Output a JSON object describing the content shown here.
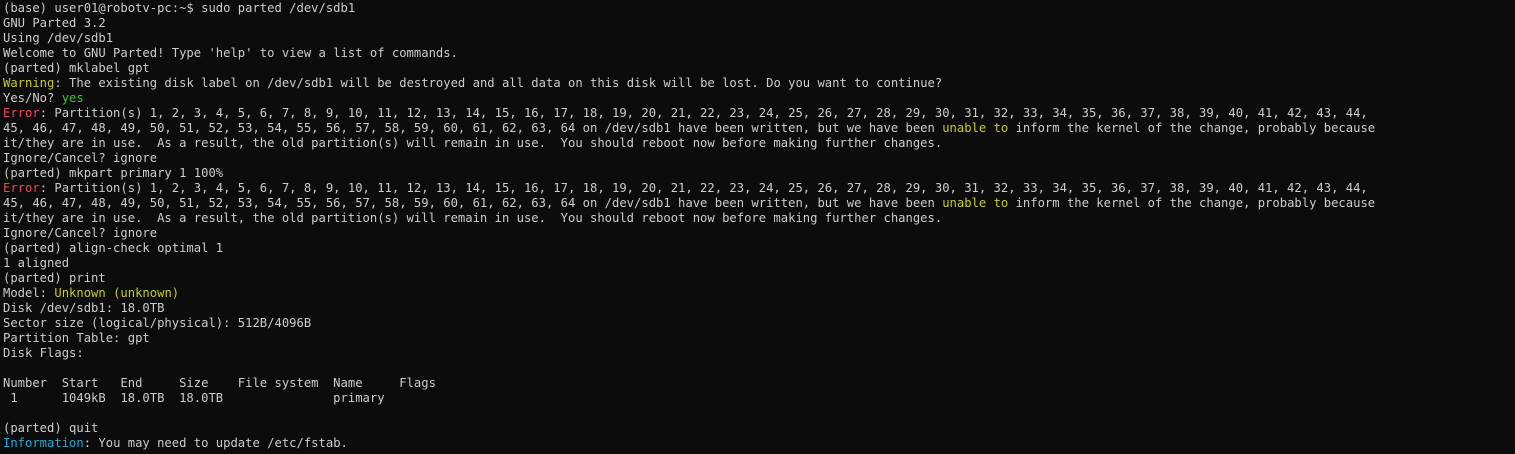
{
  "terminal": {
    "colors": {
      "background": "#0c0c0c",
      "foreground": "#cccccc",
      "warning": "#c8c832",
      "error": "#e74856",
      "highlight": "#c8c832",
      "answer": "#3ec23e",
      "information": "#2aa8d8"
    },
    "lines": [
      [
        {
          "t": "(base) user01@robotv-pc:~$ sudo parted /dev/sdb1",
          "c": "default"
        }
      ],
      [
        {
          "t": "GNU Parted 3.2",
          "c": "default"
        }
      ],
      [
        {
          "t": "Using /dev/sdb1",
          "c": "default"
        }
      ],
      [
        {
          "t": "Welcome to GNU Parted! Type 'help' to view a list of commands.",
          "c": "default"
        }
      ],
      [
        {
          "t": "(parted) mklabel gpt",
          "c": "default"
        }
      ],
      [
        {
          "t": "Warning",
          "c": "warning"
        },
        {
          "t": ": The existing disk label on /dev/sdb1 will be destroyed and all data on this disk will be lost. Do you want to continue?",
          "c": "default"
        }
      ],
      [
        {
          "t": "Yes/No? ",
          "c": "default"
        },
        {
          "t": "yes",
          "c": "green"
        }
      ],
      [
        {
          "t": "Error",
          "c": "error"
        },
        {
          "t": ": Partition(s) 1, 2, 3, 4, 5, 6, 7, 8, 9, 10, 11, 12, 13, 14, 15, 16, 17, 18, 19, 20, 21, 22, 23, 24, 25, 26, 27, 28, 29, 30, 31, 32, 33, 34, 35, 36, 37, 38, 39, 40, 41, 42, 43, 44,",
          "c": "default"
        }
      ],
      [
        {
          "t": "45, 46, 47, 48, 49, 50, 51, 52, 53, 54, 55, 56, 57, 58, 59, 60, 61, 62, 63, 64 on /dev/sdb1 have been written, but we have been ",
          "c": "default"
        },
        {
          "t": "unable to",
          "c": "yellow"
        },
        {
          "t": " inform the kernel of the change, probably because",
          "c": "default"
        }
      ],
      [
        {
          "t": "it/they are in use.  As a result, the old partition(s) will remain in use.  You should reboot now before making further changes.",
          "c": "default"
        }
      ],
      [
        {
          "t": "Ignore/Cancel? ignore",
          "c": "default"
        }
      ],
      [
        {
          "t": "(parted) mkpart primary 1 100%",
          "c": "default"
        }
      ],
      [
        {
          "t": "Error",
          "c": "error"
        },
        {
          "t": ": Partition(s) 1, 2, 3, 4, 5, 6, 7, 8, 9, 10, 11, 12, 13, 14, 15, 16, 17, 18, 19, 20, 21, 22, 23, 24, 25, 26, 27, 28, 29, 30, 31, 32, 33, 34, 35, 36, 37, 38, 39, 40, 41, 42, 43, 44,",
          "c": "default"
        }
      ],
      [
        {
          "t": "45, 46, 47, 48, 49, 50, 51, 52, 53, 54, 55, 56, 57, 58, 59, 60, 61, 62, 63, 64 on /dev/sdb1 have been written, but we have been ",
          "c": "default"
        },
        {
          "t": "unable to",
          "c": "yellow"
        },
        {
          "t": " inform the kernel of the change, probably because",
          "c": "default"
        }
      ],
      [
        {
          "t": "it/they are in use.  As a result, the old partition(s) will remain in use.  You should reboot now before making further changes.",
          "c": "default"
        }
      ],
      [
        {
          "t": "Ignore/Cancel? ignore",
          "c": "default"
        }
      ],
      [
        {
          "t": "(parted) align-check optimal 1",
          "c": "default"
        }
      ],
      [
        {
          "t": "1 aligned",
          "c": "default"
        }
      ],
      [
        {
          "t": "(parted) print",
          "c": "default"
        }
      ],
      [
        {
          "t": "Model: ",
          "c": "default"
        },
        {
          "t": "Unknown",
          "c": "yellow"
        },
        {
          "t": " (unknown)",
          "c": "yellow"
        }
      ],
      [
        {
          "t": "Disk /dev/sdb1: 18.0TB",
          "c": "default"
        }
      ],
      [
        {
          "t": "Sector size (logical/physical): 512B/4096B",
          "c": "default"
        }
      ],
      [
        {
          "t": "Partition Table: gpt",
          "c": "default"
        }
      ],
      [
        {
          "t": "Disk Flags:",
          "c": "default"
        }
      ],
      [
        {
          "t": "",
          "c": "default"
        }
      ],
      [
        {
          "t": "Number  Start   End     Size    File system  Name     Flags",
          "c": "default"
        }
      ],
      [
        {
          "t": " 1      1049kB  18.0TB  18.0TB               primary",
          "c": "default"
        }
      ],
      [
        {
          "t": "",
          "c": "default"
        }
      ],
      [
        {
          "t": "(parted) quit",
          "c": "default"
        }
      ],
      [
        {
          "t": "Information",
          "c": "info"
        },
        {
          "t": ": You may need to update /etc/fstab.",
          "c": "default"
        }
      ]
    ]
  }
}
